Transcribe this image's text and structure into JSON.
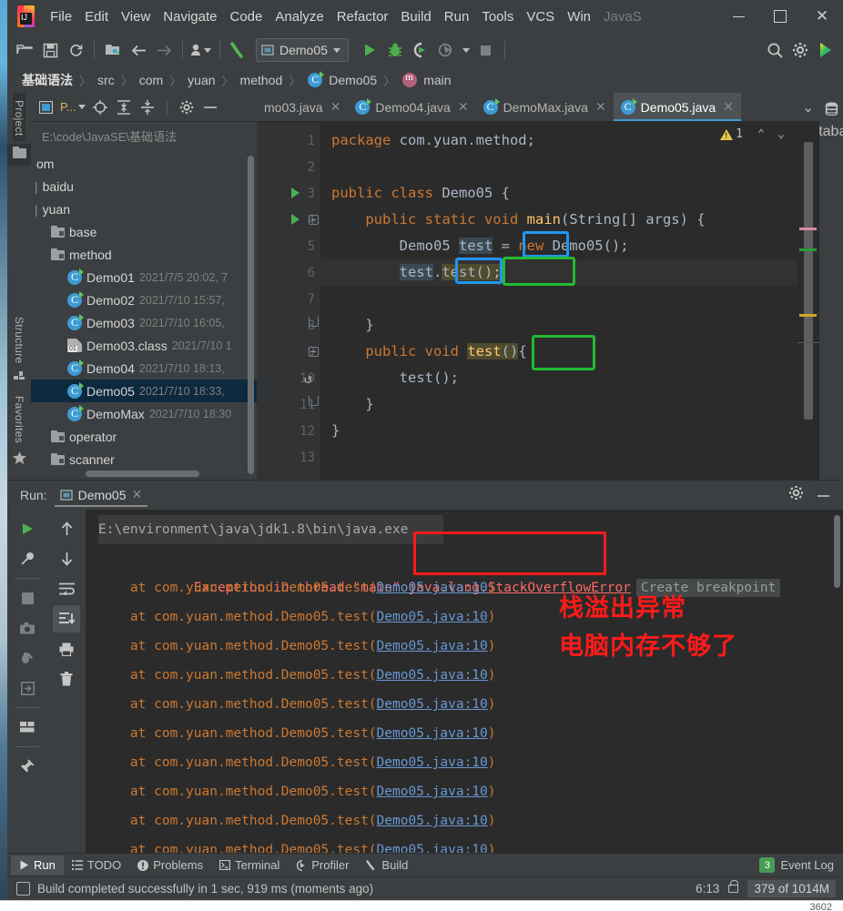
{
  "window": {
    "title_ghost": "JavaS",
    "minimize": "–",
    "maximize": "□",
    "close": "✕"
  },
  "menubar": {
    "items": [
      "File",
      "Edit",
      "View",
      "Navigate",
      "Code",
      "Analyze",
      "Refactor",
      "Build",
      "Run",
      "Tools",
      "VCS",
      "Win"
    ]
  },
  "toolbar": {
    "icons": [
      "open-folder-icon",
      "save-icon",
      "sync-icon",
      "project-structure-icon",
      "back-arrow-icon",
      "forward-arrow-icon",
      "vcs-user-icon",
      "build-hammer-icon"
    ],
    "run_config": "Demo05",
    "run_label": "Run",
    "debug_label": "Debug",
    "coverage_label": "Run with Coverage",
    "profile_label": "Profile",
    "stop_label": "Stop",
    "search_label": "Search Everywhere",
    "settings_label": "Settings"
  },
  "breadcrumb": {
    "items": [
      {
        "label": "基础语法",
        "icon": ""
      },
      {
        "label": "src",
        "icon": ""
      },
      {
        "label": "com",
        "icon": ""
      },
      {
        "label": "yuan",
        "icon": ""
      },
      {
        "label": "method",
        "icon": ""
      },
      {
        "label": "Demo05",
        "icon": "class-icon"
      },
      {
        "label": "main",
        "icon": "method-icon"
      }
    ],
    "separator": "〉"
  },
  "left_rail": {
    "project_label": "Project",
    "structure_label": "Structure",
    "favorites_label": "Favorites"
  },
  "right_rail": {
    "database_label": "Database"
  },
  "project_panel": {
    "title": "P...",
    "path": "E:\\code\\JavaSE\\基础语法",
    "header_icons": [
      "project-view-icon",
      "locate-icon",
      "expand-all-icon",
      "collapse-all-icon",
      "gear-icon",
      "hide-icon"
    ],
    "tree": [
      {
        "label": "om",
        "date": "",
        "icon": "none",
        "indent": 0,
        "selected": false
      },
      {
        "label": "baidu",
        "date": "",
        "icon": "none",
        "indent": 0,
        "selected": false
      },
      {
        "label": "yuan",
        "date": "",
        "icon": "none",
        "indent": 0,
        "selected": false
      },
      {
        "label": "base",
        "date": "",
        "icon": "folder",
        "indent": 1,
        "selected": false
      },
      {
        "label": "method",
        "date": "",
        "icon": "folder",
        "indent": 1,
        "selected": false
      },
      {
        "label": "Demo01",
        "date": "2021/7/5 20:02, 7",
        "icon": "class",
        "indent": 2,
        "selected": false
      },
      {
        "label": "Demo02",
        "date": "2021/7/10 15:57,",
        "icon": "class",
        "indent": 2,
        "selected": false
      },
      {
        "label": "Demo03",
        "date": "2021/7/10 16:05,",
        "icon": "class",
        "indent": 2,
        "selected": false
      },
      {
        "label": "Demo03.class",
        "date": "2021/7/10 1",
        "icon": "classfile",
        "indent": 2,
        "selected": false
      },
      {
        "label": "Demo04",
        "date": "2021/7/10 18:13,",
        "icon": "class",
        "indent": 2,
        "selected": false
      },
      {
        "label": "Demo05",
        "date": "2021/7/10 18:33,",
        "icon": "class",
        "indent": 2,
        "selected": true
      },
      {
        "label": "DemoMax",
        "date": "2021/7/10 18:30",
        "icon": "class",
        "indent": 2,
        "selected": false
      },
      {
        "label": "operator",
        "date": "",
        "icon": "folder",
        "indent": 1,
        "selected": false
      },
      {
        "label": "scanner",
        "date": "",
        "icon": "folder",
        "indent": 1,
        "selected": false
      }
    ]
  },
  "editor": {
    "tabs": [
      {
        "label": "mo03.java",
        "icon": "",
        "active": false
      },
      {
        "label": "Demo04.java",
        "icon": "class-icon",
        "active": false
      },
      {
        "label": "DemoMax.java",
        "icon": "class-icon",
        "active": false
      },
      {
        "label": "Demo05.java",
        "icon": "class-icon",
        "active": true
      }
    ],
    "close_glyph": "✕",
    "tab_list_glyph": "⌄",
    "warning_count": "1",
    "nav_up": "⌃",
    "nav_down": "⌄",
    "line_numbers": [
      "1",
      "2",
      "3",
      "4",
      "5",
      "6",
      "7",
      "8",
      "9",
      "10",
      "11",
      "12",
      "13"
    ],
    "code_lines": [
      "package com.yuan.method;",
      "",
      "public class Demo05 {",
      "    public static void main(String[] args) {",
      "        Demo05 test = new Demo05();",
      "        test.test();",
      "",
      "    }",
      "    public void test(){",
      "        test();",
      "    }",
      "}",
      ""
    ]
  },
  "run_panel": {
    "label": "Run:",
    "tab_name": "Demo05",
    "tab_close": "✕",
    "settings_icon": "gear-icon",
    "minimize_icon": "minimize-icon",
    "console_lines": [
      {
        "type": "path",
        "text": "E:\\environment\\java\\jdk1.8\\bin\\java.exe ..."
      },
      {
        "type": "exception",
        "prefix": "Exception in thread \"main\" java.lang.",
        "link": "StackOverflowError",
        "badge": "Create breakpoint"
      },
      {
        "type": "stack",
        "text": "    at com.yuan.method.Demo05.test(",
        "link": "Demo05.java:10",
        "suffix": ")"
      },
      {
        "type": "stack",
        "text": "    at com.yuan.method.Demo05.test(",
        "link": "Demo05.java:10",
        "suffix": ")"
      },
      {
        "type": "stack",
        "text": "    at com.yuan.method.Demo05.test(",
        "link": "Demo05.java:10",
        "suffix": ")"
      },
      {
        "type": "stack",
        "text": "    at com.yuan.method.Demo05.test(",
        "link": "Demo05.java:10",
        "suffix": ")"
      },
      {
        "type": "stack",
        "text": "    at com.yuan.method.Demo05.test(",
        "link": "Demo05.java:10",
        "suffix": ")"
      },
      {
        "type": "stack",
        "text": "    at com.yuan.method.Demo05.test(",
        "link": "Demo05.java:10",
        "suffix": ")"
      },
      {
        "type": "stack",
        "text": "    at com.yuan.method.Demo05.test(",
        "link": "Demo05.java:10",
        "suffix": ")"
      },
      {
        "type": "stack",
        "text": "    at com.yuan.method.Demo05.test(",
        "link": "Demo05.java:10",
        "suffix": ")"
      },
      {
        "type": "stack",
        "text": "    at com.yuan.method.Demo05.test(",
        "link": "Demo05.java:10",
        "suffix": ")"
      },
      {
        "type": "stack",
        "text": "    at com.yuan.method.Demo05.test(",
        "link": "Demo05.java:10",
        "suffix": ")"
      }
    ],
    "annotations": [
      "栈溢出异常",
      "电脑内存不够了"
    ],
    "toolbar_icons": [
      "rerun-icon",
      "wrench-icon",
      "stop-icon",
      "camera-icon",
      "dump-threads-icon",
      "export-icon",
      "layout-icon",
      "pin-icon"
    ],
    "toolbar_icons2": [
      "scroll-up-icon",
      "scroll-down-icon",
      "soft-wrap-icon",
      "scroll-to-end-icon",
      "print-icon",
      "trash-icon"
    ]
  },
  "bottom_tabs": [
    {
      "label": "Run",
      "icon": "play-icon",
      "active": true
    },
    {
      "label": "TODO",
      "icon": "list-icon",
      "active": false
    },
    {
      "label": "Problems",
      "icon": "exclamation-icon",
      "active": false
    },
    {
      "label": "Terminal",
      "icon": "terminal-icon",
      "active": false
    },
    {
      "label": "Profiler",
      "icon": "gauge-icon",
      "active": false
    },
    {
      "label": "Build",
      "icon": "hammer-icon",
      "active": false
    }
  ],
  "event_log": {
    "count": "3",
    "label": "Event Log"
  },
  "statusbar": {
    "message": "Build completed successfully in 1 sec, 919 ms (moments ago)",
    "caret_position": "6:13",
    "lock_icon": "unlocked-icon",
    "memory": "379 of 1014M"
  },
  "desktop": {
    "taskbar_hint": "3602"
  },
  "colors": {
    "accent_blue": "#2196f3",
    "accent_green": "#22bb33",
    "accent_red": "#ff1a1a",
    "bg_editor": "#2b2b2b",
    "bg_panel": "#3c3f41",
    "link": "#6897d3",
    "error_text": "#ff6b68",
    "keyword": "#cc7832",
    "method": "#ffc66d"
  }
}
